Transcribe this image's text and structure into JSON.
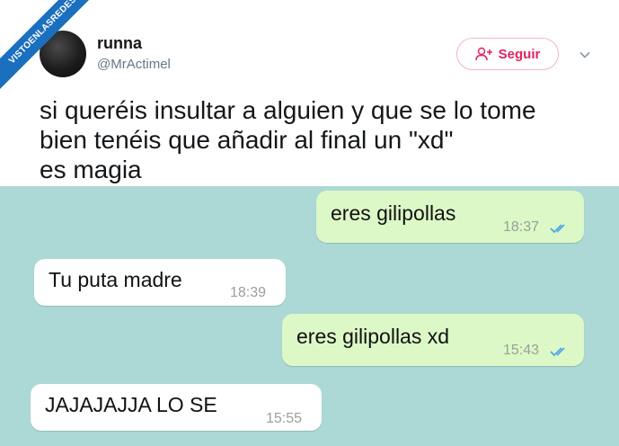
{
  "watermark": "VISTOENLASREDES",
  "tweet": {
    "name": "runna",
    "handle": "@MrActimel",
    "follow_label": "Seguir",
    "text_lines": [
      "si queréis insultar a alguien y que se lo tome",
      "bien tenéis que añadir al final un \"xd\"",
      "es magia"
    ]
  },
  "chat": {
    "messages": [
      {
        "direction": "outgoing",
        "text": "eres gilipollas",
        "time": "18:37",
        "status": "read"
      },
      {
        "direction": "incoming",
        "text": "Tu puta madre",
        "time": "18:39"
      },
      {
        "direction": "outgoing",
        "text": "eres gilipollas xd",
        "time": "15:43",
        "status": "read"
      },
      {
        "direction": "incoming",
        "text": "JAJAJAJJA LO SE",
        "time": "15:55"
      }
    ]
  },
  "colors": {
    "chat_background": "#acd9d5",
    "outgoing_bubble": "#dcf8c6",
    "incoming_bubble": "#ffffff",
    "follow_accent": "#e0245e",
    "read_ticks": "#4fa6e8",
    "watermark": "#1b6fbf"
  },
  "icons": [
    "add-user-icon",
    "chevron-down-icon",
    "double-check-icon"
  ]
}
